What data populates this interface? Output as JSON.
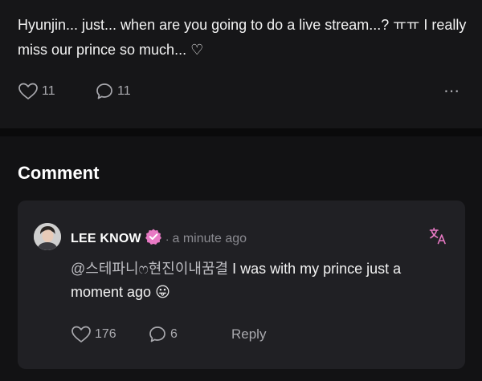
{
  "post": {
    "text": "Hyunjin... just... when are you going to do a live stream...? ㅠㅠ I really miss our prince so much... ♡",
    "likes": "11",
    "comments": "11",
    "more_icon": "⋯"
  },
  "section": {
    "title": "Comment"
  },
  "comment": {
    "author": "LEE KNOW",
    "separator": "·",
    "time": "a minute ago",
    "mention": "@스테파니ෆ현진이내꿈결",
    "text": " I was with my prince just a moment ago",
    "emoji": "😛",
    "likes": "176",
    "replies": "6",
    "reply_label": "Reply"
  },
  "colors": {
    "background": "#121214",
    "card": "#202024",
    "accent": "#e879c4",
    "muted": "#a9a9ae"
  },
  "icons": {
    "like": "heart-icon",
    "comment": "speech-bubble-icon",
    "verified": "verified-badge-icon",
    "translate": "translate-icon",
    "more": "more-options-icon"
  }
}
